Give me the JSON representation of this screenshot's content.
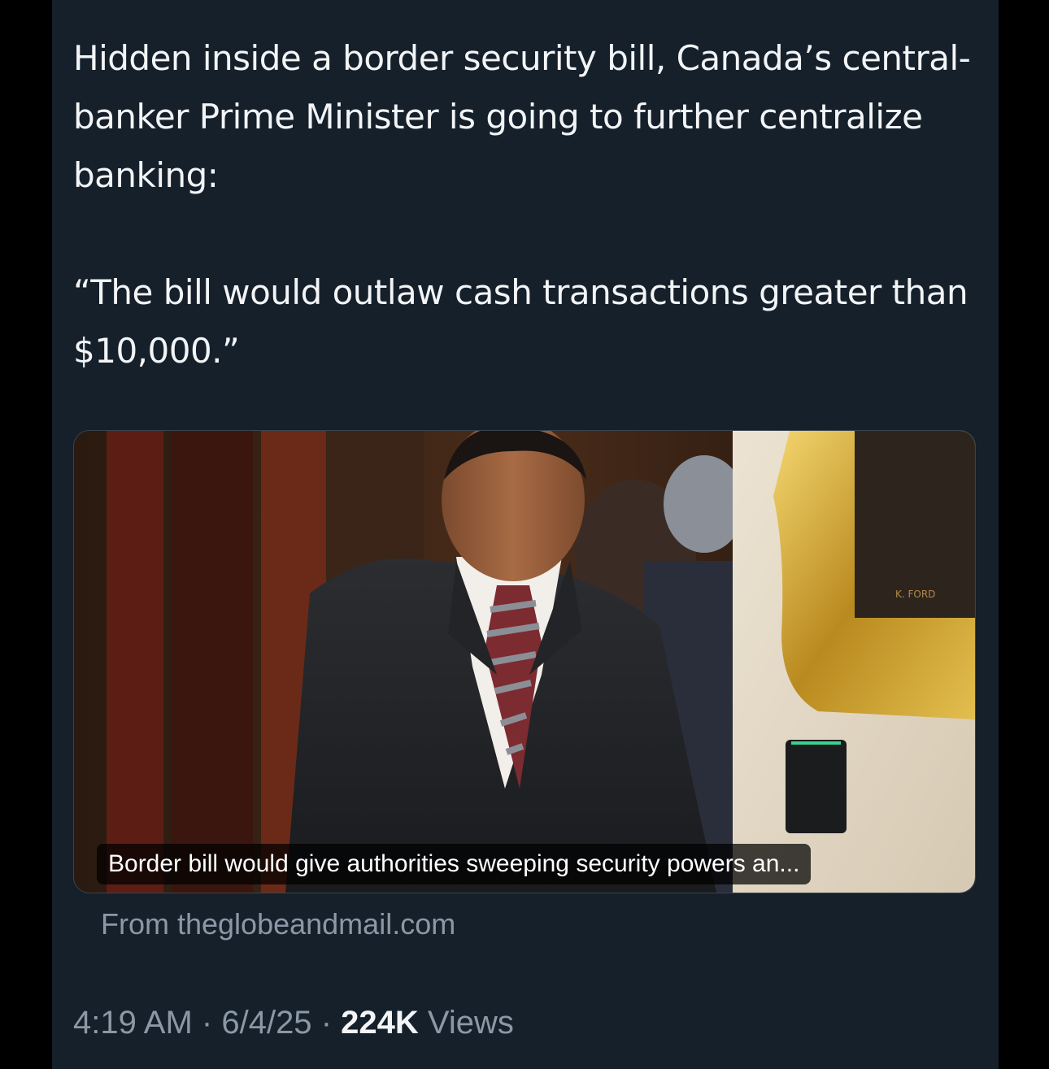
{
  "tweet": {
    "paragraph_1": "Hidden inside a border security bill, Canada’s central-banker Prime Minister is going to further centralize banking:",
    "paragraph_2": "“The bill would outlaw cash transactions greater than $10,000.”",
    "card": {
      "title": "Border bill would give authorities sweeping security powers an...",
      "source": "From theglobeandmail.com",
      "frame_plaque": "K. FORD"
    },
    "meta": {
      "time": "4:19 AM",
      "separator": "·",
      "date": "6/4/25",
      "views_count": "224K",
      "views_label": "Views"
    }
  },
  "colors": {
    "background": "#15202b",
    "text_primary": "#f2f4f6",
    "text_secondary": "#8b98a5"
  }
}
